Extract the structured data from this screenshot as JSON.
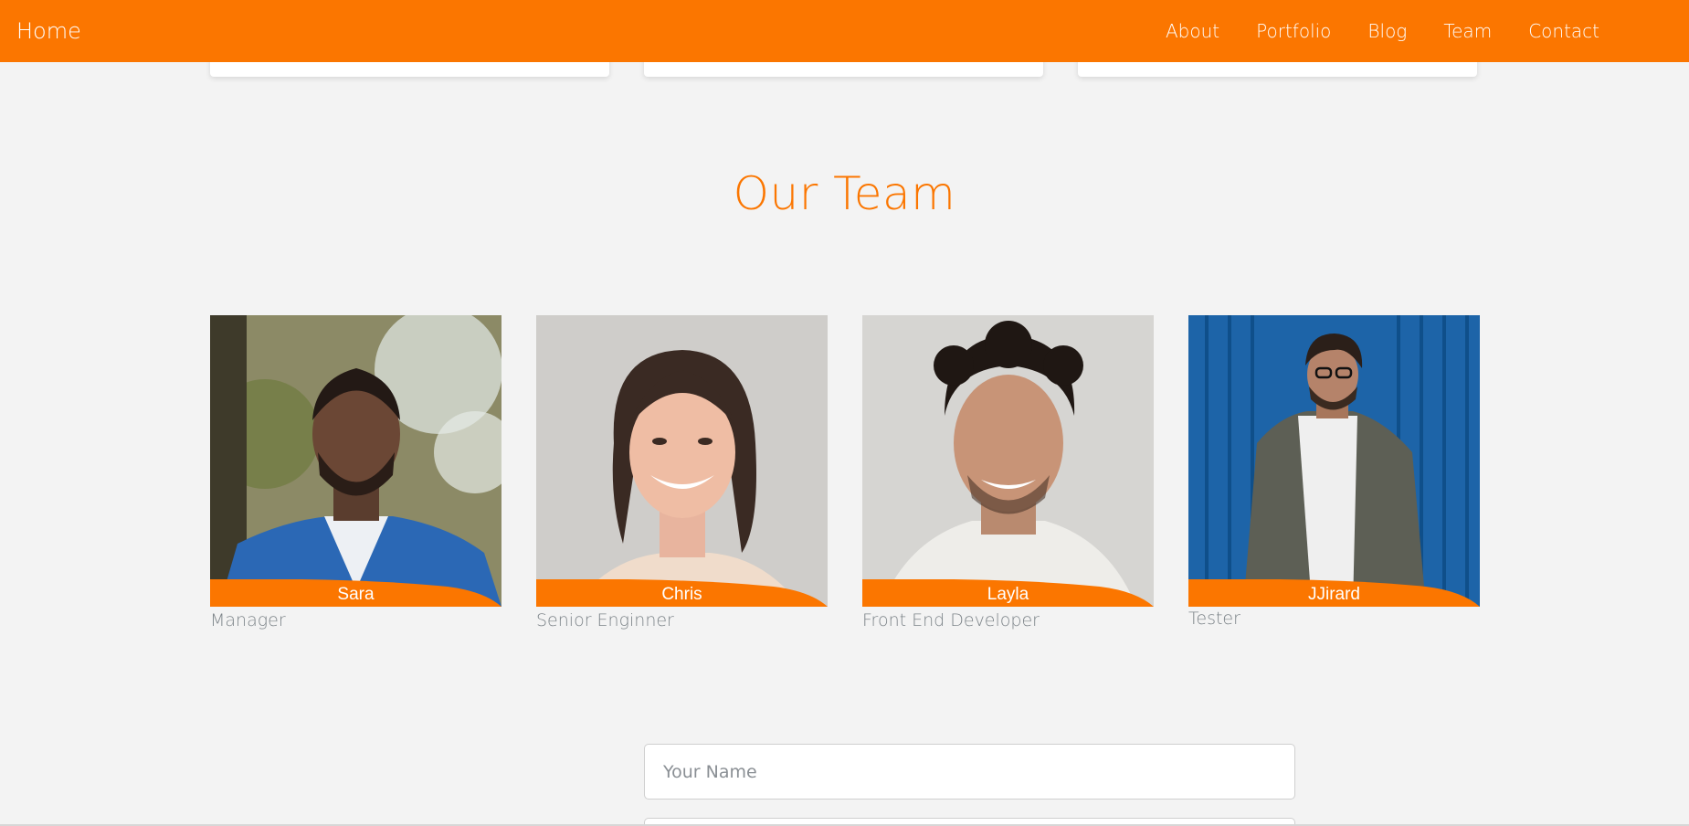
{
  "nav": {
    "brand": "Home",
    "links": [
      "About",
      "Portfolio",
      "Blog",
      "Team",
      "Contact"
    ]
  },
  "team": {
    "title": "Our Team",
    "members": [
      {
        "name": "Sara",
        "role": "Manager"
      },
      {
        "name": "Chris",
        "role": "Senior Enginner"
      },
      {
        "name": "Layla",
        "role": "Front End Developer"
      },
      {
        "name": "JJirard",
        "role": "Tester"
      }
    ]
  },
  "contact": {
    "name_placeholder": "Your Name"
  },
  "colors": {
    "accent": "#fb7600",
    "background": "#f3f3f3",
    "role_text": "#7d8489"
  }
}
